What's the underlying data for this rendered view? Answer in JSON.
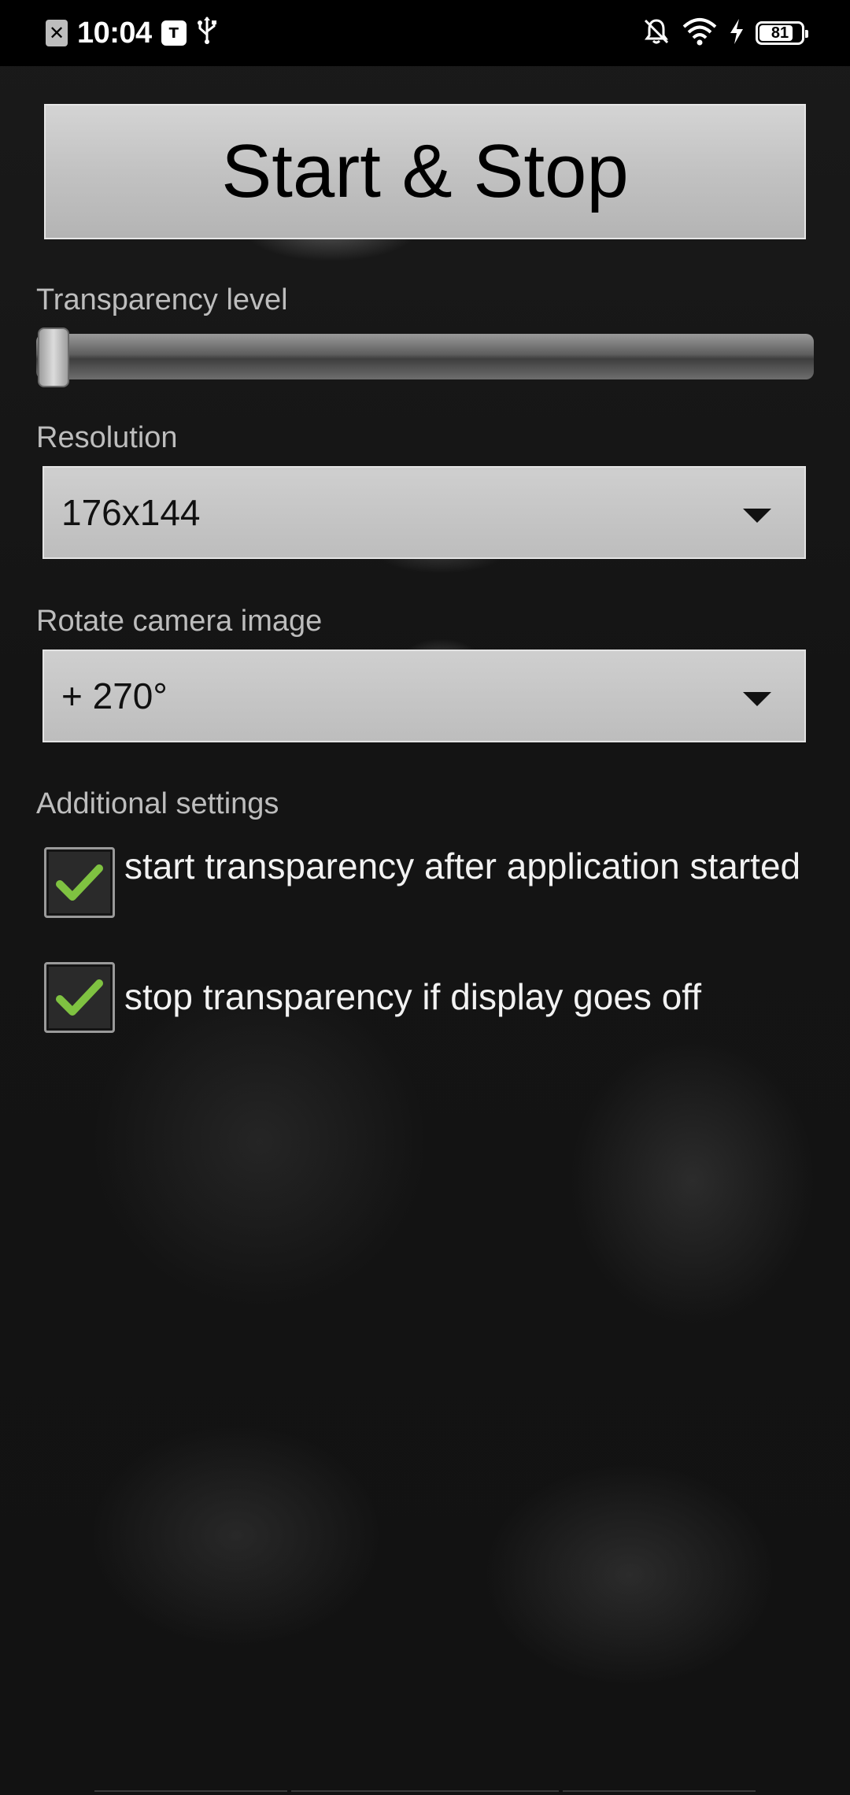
{
  "status_bar": {
    "time": "10:04",
    "left_icons": [
      "close-notification-icon",
      "teams-icon",
      "usb-icon"
    ],
    "right_icons": [
      "mute-bell-icon",
      "wifi-icon",
      "charging-bolt-icon",
      "battery-icon"
    ],
    "battery_level": "81",
    "battery_fraction": 0.81
  },
  "main": {
    "start_stop_label": "Start & Stop",
    "transparency": {
      "label": "Transparency level",
      "value_fraction": 0.0
    },
    "resolution": {
      "label": "Resolution",
      "selected": "176x144"
    },
    "rotate": {
      "label": "Rotate camera image",
      "selected": "+ 270°"
    },
    "additional": {
      "label": "Additional settings",
      "options": [
        {
          "text": "start transparency after application started",
          "checked": true
        },
        {
          "text": "stop transparency if display goes off",
          "checked": true
        }
      ]
    }
  },
  "colors": {
    "check_green": "#7fc241",
    "status_bar_bg": "#000000",
    "label_text": "#bdbdbd"
  }
}
